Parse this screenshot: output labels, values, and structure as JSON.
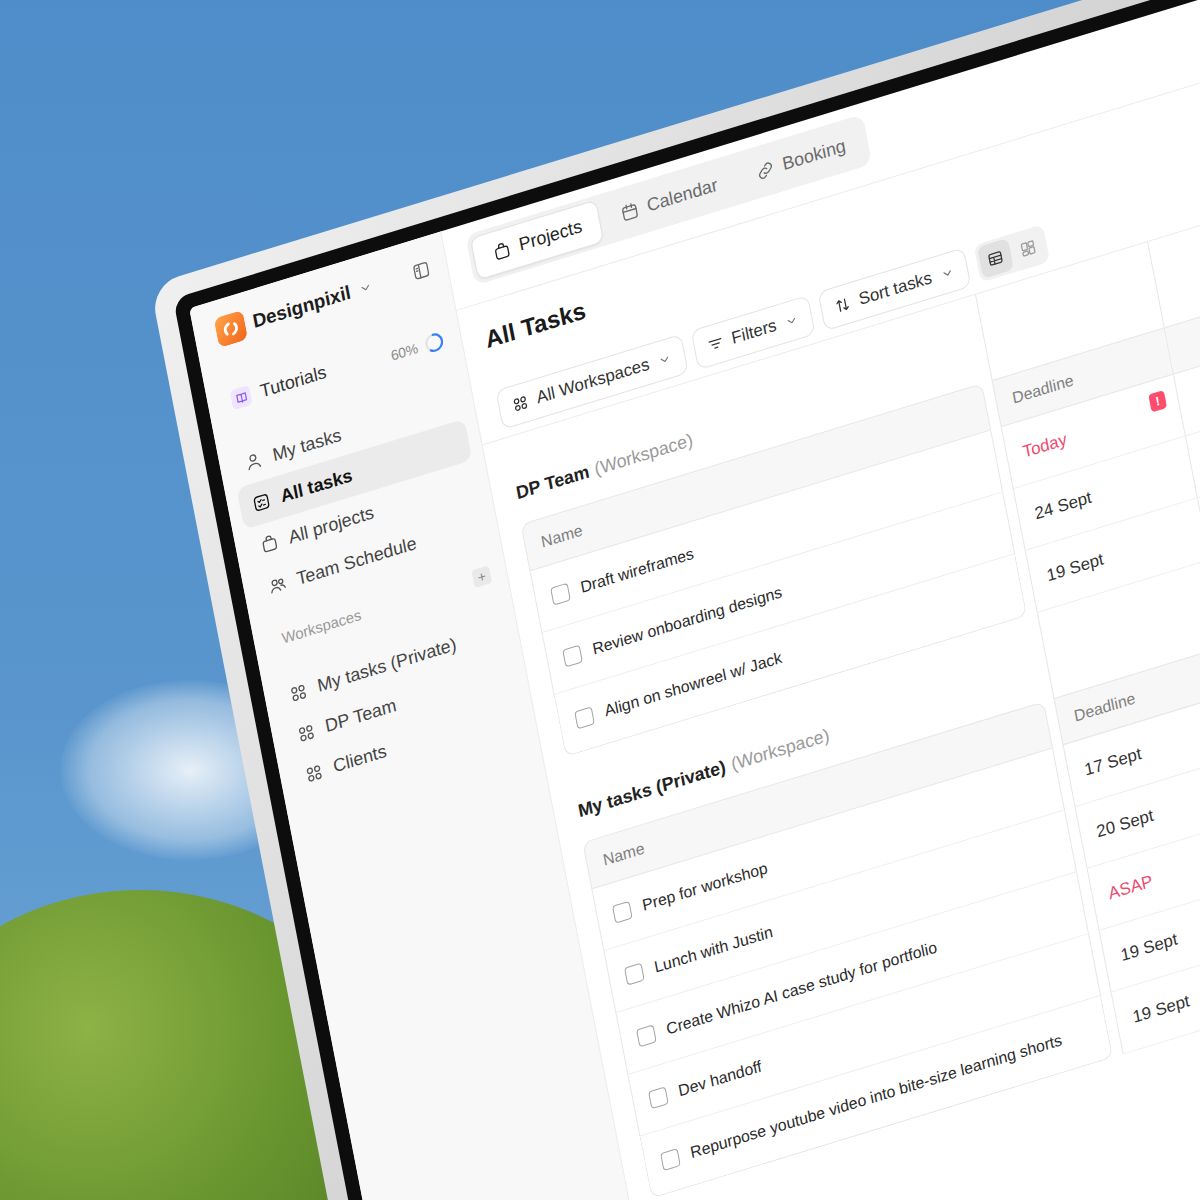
{
  "sidebar": {
    "workspace": "Designpixil",
    "tutorials": {
      "label": "Tutorials",
      "progress": "60%",
      "level": 0.6
    },
    "nav": [
      {
        "label": "My tasks",
        "selected": false
      },
      {
        "label": "All tasks",
        "selected": true
      },
      {
        "label": "All projects",
        "selected": false
      },
      {
        "label": "Team Schedule",
        "selected": false
      }
    ],
    "workspaces_label": "Workspaces",
    "add_button": "+",
    "workspaces": [
      {
        "label": "My tasks (Private)",
        "selected": false
      },
      {
        "label": "DP Team",
        "selected": false
      },
      {
        "label": "Clients",
        "selected": false
      }
    ]
  },
  "tabs": [
    {
      "label": "Projects",
      "selected": true
    },
    {
      "label": "Calendar",
      "selected": false
    },
    {
      "label": "Booking",
      "selected": false
    }
  ],
  "page": {
    "title": "All Tasks"
  },
  "toolbar": {
    "workspace_filter": "All Workspaces",
    "filters": "Filters",
    "sort": "Sort tasks",
    "views": [
      {
        "kind": "table",
        "selected": true
      },
      {
        "kind": "board",
        "selected": false
      }
    ]
  },
  "groups": [
    {
      "name": "DP Team",
      "type": "(Workspace)",
      "columns": [
        "Name",
        "Deadline"
      ],
      "tasks": [
        {
          "name": "Draft wireframes",
          "checked": false,
          "deadline": "Today",
          "urgent": true,
          "badge": "!"
        },
        {
          "name": "Review onboarding designs",
          "checked": false,
          "deadline": "24 Sept",
          "urgent": false
        },
        {
          "name": "Align on showreel w/ Jack",
          "checked": false,
          "deadline": "19 Sept",
          "urgent": false
        }
      ]
    },
    {
      "name": "My tasks (Private)",
      "type": "(Workspace)",
      "columns": [
        "Name",
        "Deadline"
      ],
      "tasks": [
        {
          "name": "Prep for workshop",
          "checked": false,
          "deadline": "17 Sept",
          "urgent": false
        },
        {
          "name": "Lunch with Justin",
          "checked": false,
          "deadline": "20 Sept",
          "urgent": false
        },
        {
          "name": "Create Whizo AI case study for portfolio",
          "checked": false,
          "deadline": "ASAP",
          "urgent": true
        },
        {
          "name": "Dev handoff",
          "checked": false,
          "deadline": "19 Sept",
          "urgent": false
        },
        {
          "name": "Repurpose youtube video into bite-size learning shorts",
          "checked": false,
          "deadline": "19 Sept",
          "urgent": false
        }
      ]
    }
  ]
}
